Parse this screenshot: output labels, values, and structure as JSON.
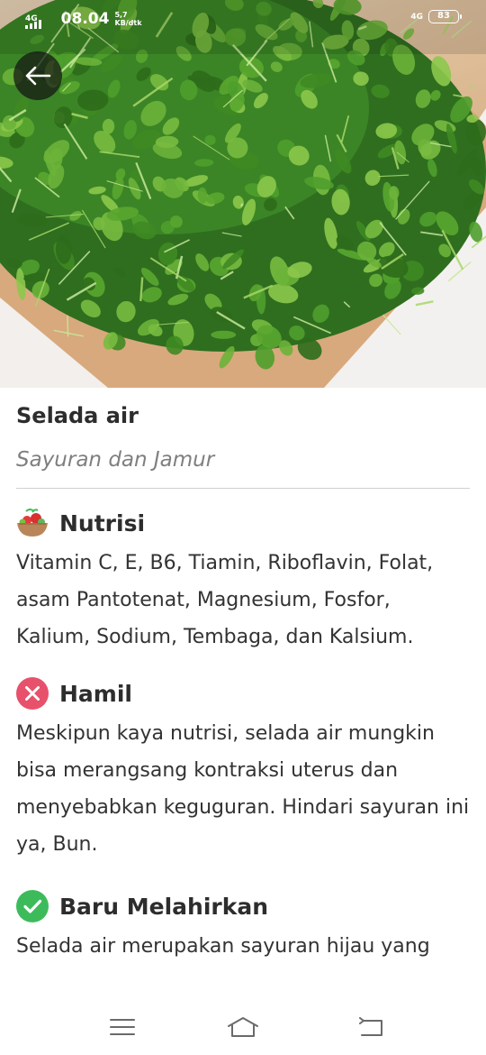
{
  "status_bar": {
    "network_left": "4G",
    "time": "08.04",
    "speed_value": "5,7",
    "speed_unit": "KB/dtk",
    "network_right": "4G",
    "battery": "83"
  },
  "hero": {
    "icon": "watercress-photo"
  },
  "item": {
    "title": "Selada air",
    "category": "Sayuran dan Jamur"
  },
  "sections": {
    "nutrisi": {
      "title": "Nutrisi",
      "icon": "vegetable-bowl-icon",
      "text": "Vitamin C, E, B6, Tiamin, Riboflavin, Folat, asam Pantotenat, Magnesium, Fosfor, Kalium, Sodium, Tembaga, dan Kalsium."
    },
    "hamil": {
      "title": "Hamil",
      "icon": "cross-circle-icon",
      "color": "#e8516b",
      "text": "Meskipun kaya nutrisi, selada air mungkin bisa merangsang kontraksi uterus dan menyebabkan keguguran. Hindari sayuran ini ya, Bun."
    },
    "baru_melahirkan": {
      "title": "Baru Melahirkan",
      "icon": "check-circle-icon",
      "color": "#3dbb5b",
      "text": "Selada air merupakan sayuran hijau yang"
    }
  }
}
